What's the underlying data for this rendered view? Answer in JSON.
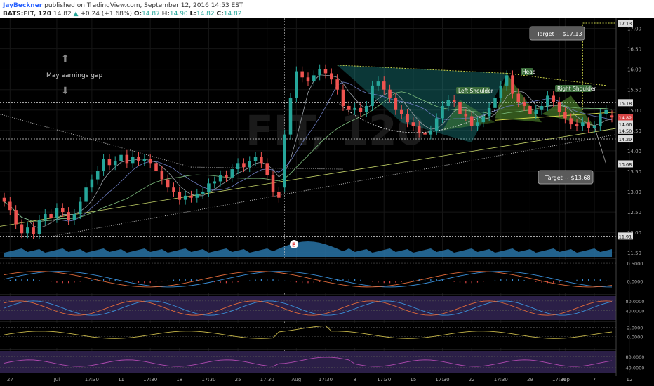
{
  "header": {
    "author": "JayBeckner",
    "published": "published on TradingView.com, September 12, 2016 14:53 EST",
    "symbol": "BATS:FIT, 120",
    "last": "14.82",
    "change": "+0.24 (+1.68%)",
    "open_label": "O:",
    "open": "14.87",
    "high_label": "H:",
    "high": "14.90",
    "low_label": "L:",
    "low": "14.82",
    "close_label": "C:",
    "close": "14.82"
  },
  "colors": {
    "up": "#26a69a",
    "down": "#ef5350",
    "pattern_fill": "#1f9e9e",
    "volume": "#2a7ab0",
    "target_box": "#5a5a5a"
  },
  "watermark": {
    "symbol": "FIT, 120"
  },
  "annotations": {
    "gap_label": "May earnings gap",
    "head": "Head",
    "left_shoulder": "Left Shoulder",
    "right_shoulder": "Right Shoulder",
    "target_up": "Target ~ $17.13",
    "target_down": "Target ~ $13.68",
    "earnings_marker": "E"
  },
  "chart_data": [
    {
      "type": "candlestick",
      "name": "price",
      "ylim": [
        11.4,
        17.25
      ],
      "y_ticks": [
        "11.50",
        "12.00",
        "12.50",
        "13.00",
        "13.50",
        "14.00",
        "14.50",
        "15.00",
        "15.50",
        "16.00",
        "16.50",
        "17.00"
      ],
      "price_labels": [
        {
          "value": 17.13,
          "text": "17.13"
        },
        {
          "value": 15.18,
          "text": "15.18"
        },
        {
          "value": 14.82,
          "text": "14.82"
        },
        {
          "value": 14.66,
          "text": "14.66"
        },
        {
          "value": 14.5,
          "text": "14.50"
        },
        {
          "value": 14.29,
          "text": "14.29"
        },
        {
          "value": 13.68,
          "text": "13.68"
        },
        {
          "value": 11.91,
          "text": "11.91"
        }
      ],
      "horizontal_levels": [
        16.45,
        15.18,
        14.29,
        11.91
      ],
      "x_ticks": [
        {
          "bar": 1,
          "label": "27"
        },
        {
          "bar": 9,
          "label": "Jul"
        },
        {
          "bar": 15,
          "label": "17:30"
        },
        {
          "bar": 20,
          "label": "11"
        },
        {
          "bar": 25,
          "label": "17:30"
        },
        {
          "bar": 30,
          "label": "18"
        },
        {
          "bar": 35,
          "label": "17:30"
        },
        {
          "bar": 40,
          "label": "25"
        },
        {
          "bar": 45,
          "label": "17:30"
        },
        {
          "bar": 50,
          "label": "Aug"
        },
        {
          "bar": 55,
          "label": "17:30"
        },
        {
          "bar": 60,
          "label": "8"
        },
        {
          "bar": 65,
          "label": "17:30"
        },
        {
          "bar": 70,
          "label": "15"
        },
        {
          "bar": 75,
          "label": "17:30"
        },
        {
          "bar": 80,
          "label": "22"
        },
        {
          "bar": 85,
          "label": "17:30"
        },
        {
          "bar": 90,
          "label": "29"
        },
        {
          "bar": 95,
          "label": "17:30"
        },
        {
          "bar": 96,
          "label": "Sep"
        },
        {
          "bar": 101,
          "label": "7"
        },
        {
          "bar": 107,
          "label": "12"
        }
      ],
      "closes": [
        12.75,
        12.55,
        12.2,
        11.98,
        12.12,
        11.95,
        12.3,
        12.45,
        12.35,
        12.6,
        12.5,
        12.3,
        12.45,
        12.75,
        13.1,
        13.3,
        13.5,
        13.8,
        13.65,
        13.75,
        13.9,
        13.7,
        13.85,
        13.75,
        13.8,
        13.7,
        13.5,
        13.3,
        13.1,
        13.0,
        12.8,
        12.9,
        12.85,
        12.95,
        13.0,
        13.2,
        13.25,
        13.4,
        13.35,
        13.55,
        13.7,
        13.6,
        13.75,
        13.85,
        13.7,
        13.4,
        13.0,
        12.85,
        14.4,
        15.3,
        15.95,
        15.8,
        15.7,
        15.85,
        16.0,
        15.9,
        15.75,
        15.5,
        15.1,
        15.0,
        15.05,
        14.95,
        15.1,
        15.6,
        15.7,
        15.5,
        15.3,
        15.0,
        14.9,
        14.7,
        14.6,
        14.45,
        14.4,
        14.5,
        14.8,
        15.1,
        15.25,
        15.2,
        14.9,
        14.85,
        14.6,
        14.7,
        14.85,
        15.05,
        15.3,
        15.6,
        15.85,
        15.4,
        15.2,
        15.1,
        14.9,
        15.0,
        15.1,
        15.35,
        15.2,
        14.95,
        14.8,
        14.65,
        14.6,
        14.7,
        14.55,
        14.6,
        14.9,
        15.0,
        14.82
      ],
      "opens": [
        12.85,
        12.75,
        12.55,
        12.2,
        11.98,
        12.12,
        11.95,
        12.3,
        12.45,
        12.35,
        12.6,
        12.5,
        12.3,
        12.45,
        12.75,
        13.1,
        13.3,
        13.5,
        13.8,
        13.65,
        13.75,
        13.9,
        13.7,
        13.85,
        13.75,
        13.8,
        13.7,
        13.5,
        13.3,
        13.1,
        13.0,
        12.8,
        12.9,
        12.85,
        12.95,
        13.0,
        13.2,
        13.25,
        13.4,
        13.35,
        13.55,
        13.7,
        13.6,
        13.75,
        13.85,
        13.7,
        13.4,
        13.0,
        13.1,
        14.4,
        15.3,
        15.95,
        15.8,
        15.7,
        15.85,
        16.0,
        15.9,
        15.75,
        15.5,
        15.1,
        15.0,
        15.05,
        14.95,
        15.1,
        15.6,
        15.7,
        15.5,
        15.3,
        15.0,
        14.9,
        14.7,
        14.6,
        14.45,
        14.4,
        14.5,
        14.8,
        15.1,
        15.25,
        15.2,
        14.9,
        14.85,
        14.6,
        14.7,
        14.85,
        15.05,
        15.3,
        15.6,
        15.85,
        15.4,
        15.2,
        15.1,
        14.9,
        15.0,
        15.1,
        15.35,
        15.2,
        14.95,
        14.8,
        14.65,
        14.6,
        14.7,
        14.55,
        14.6,
        14.9,
        14.87
      ]
    },
    {
      "type": "line",
      "name": "macd",
      "y_ticks": [
        "0.5000",
        "0.0000"
      ],
      "ylim": [
        -0.35,
        0.6
      ]
    },
    {
      "type": "line",
      "name": "stochastic",
      "y_ticks": [
        "80.0000",
        "40.0000"
      ],
      "ylim": [
        0,
        100
      ]
    },
    {
      "type": "line",
      "name": "oscillator",
      "y_ticks": [
        "2.0000",
        "0.0000"
      ],
      "ylim": [
        -2.5,
        3
      ]
    },
    {
      "type": "line",
      "name": "rsi",
      "y_ticks": [
        "80.0000",
        "40.0000"
      ],
      "ylim": [
        20,
        100
      ]
    }
  ]
}
